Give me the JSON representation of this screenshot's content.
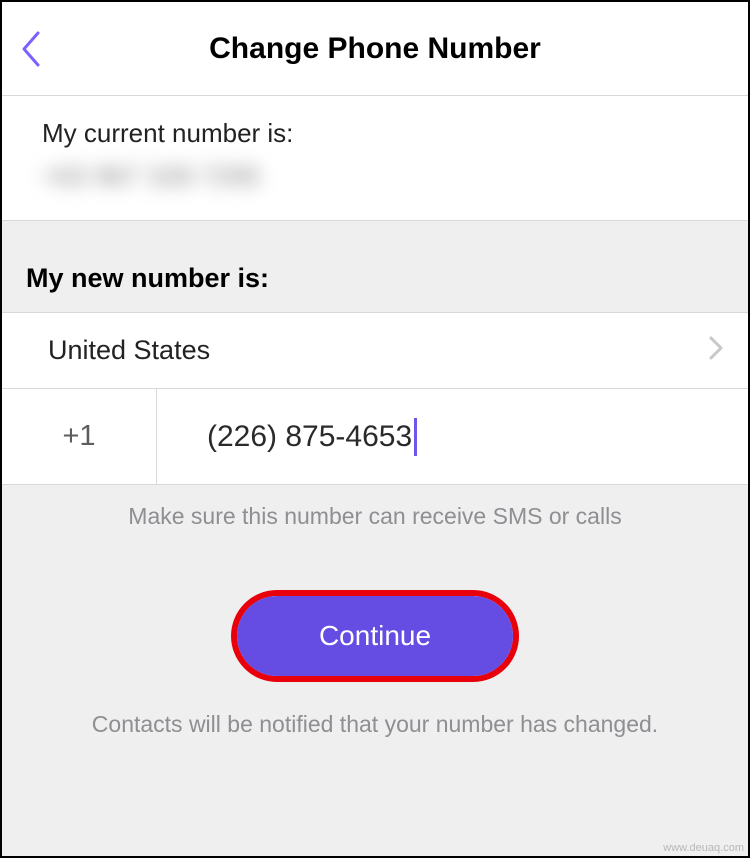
{
  "header": {
    "title": "Change Phone Number"
  },
  "current": {
    "label": "My current number is:",
    "number": "+63 967 328 7295"
  },
  "new": {
    "label": "My new number is:",
    "country": "United States",
    "code": "+1",
    "number": "(226) 875-4653"
  },
  "hint": "Make sure this number can receive SMS or calls",
  "continue_label": "Continue",
  "footer": "Contacts will be notified that your number has changed.",
  "watermark": "www.deuaq.com"
}
